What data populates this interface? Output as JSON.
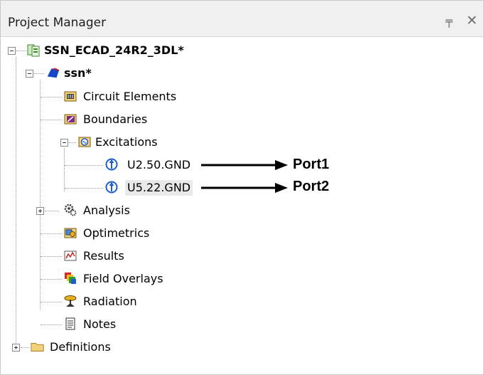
{
  "panel": {
    "title": "Project Manager",
    "pin_glyph": "╤",
    "close_glyph": "✕"
  },
  "tree": {
    "project": {
      "label": "SSN_ECAD_24R2_3DL*",
      "icon": "project-icon",
      "expanded": true
    },
    "design": {
      "label": "ssn*",
      "icon": "design-icon",
      "expanded": true
    },
    "items": [
      {
        "label": "Circuit Elements",
        "icon": "circuit-elements-icon"
      },
      {
        "label": "Boundaries",
        "icon": "boundaries-icon"
      },
      {
        "label": "Excitations",
        "icon": "excitations-icon",
        "expanded": true
      },
      {
        "label": "Analysis",
        "icon": "analysis-icon",
        "collapsed": true
      },
      {
        "label": "Optimetrics",
        "icon": "optimetrics-icon"
      },
      {
        "label": "Results",
        "icon": "results-icon"
      },
      {
        "label": "Field Overlays",
        "icon": "field-overlays-icon"
      },
      {
        "label": "Radiation",
        "icon": "radiation-icon"
      },
      {
        "label": "Notes",
        "icon": "notes-icon"
      }
    ],
    "ports": [
      {
        "label": "U2.50.GND",
        "icon": "port-icon",
        "annotation": "Port1"
      },
      {
        "label": "U5.22.GND",
        "icon": "port-icon",
        "annotation": "Port2",
        "selected": true
      }
    ],
    "definitions": {
      "label": "Definitions",
      "icon": "folder-icon",
      "collapsed": true
    }
  },
  "colors": {
    "background": "#ffffff",
    "titlebar": "#f0f0f0",
    "selection": "#e9e9e9",
    "port_icon": "#1d5fd1"
  }
}
